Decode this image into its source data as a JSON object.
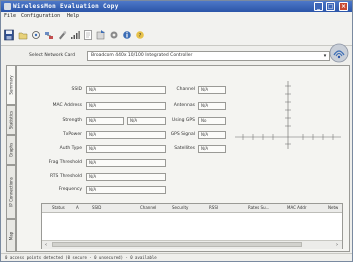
{
  "window": {
    "title": "WirelessMon Evaluation Copy",
    "controls": {
      "minimize": "_",
      "maximize": "□",
      "close": "×"
    }
  },
  "menu": {
    "file": "File",
    "configuration": "Configuration",
    "help": "Help"
  },
  "toolbar": {
    "icons": [
      "save-icon",
      "open-icon",
      "connect-icon",
      "network-icon",
      "tools-icon",
      "signal-icon",
      "log-icon",
      "export-icon",
      "settings-icon",
      "info-icon",
      "help-icon",
      "wireless-logo"
    ]
  },
  "network_card": {
    "label": "Select Network Card",
    "value": "Broadcom 440x 10/100 Integrated Controller"
  },
  "tabs": [
    "Summary",
    "Statistics",
    "Graphs",
    "IP Connections",
    "Map"
  ],
  "fields_left": [
    {
      "label": "SSID",
      "value": "N/A"
    },
    {
      "label": "MAC Address",
      "value": "N/A"
    },
    {
      "label": "Strength",
      "value": "N/A",
      "extra": "N/A"
    },
    {
      "label": "TxPower",
      "value": "N/A"
    },
    {
      "label": "Auth Type",
      "value": "N/A"
    },
    {
      "label": "Frag Threshold",
      "value": "N/A"
    },
    {
      "label": "RTS Threshold",
      "value": "N/A"
    },
    {
      "label": "Frequency",
      "value": "N/A"
    }
  ],
  "fields_right": [
    {
      "label": "Channel",
      "value": "N/A"
    },
    {
      "label": "Antennas",
      "value": "N/A"
    },
    {
      "label": "Using GPS",
      "value": "No"
    },
    {
      "label": "GPS Signal",
      "value": "N/A"
    },
    {
      "label": "Satellites",
      "value": "N/A"
    }
  ],
  "table": {
    "columns": [
      "Status",
      "A",
      "SSID",
      "Channel",
      "Security",
      "RSSI",
      "Rates Su...",
      "MAC Addr",
      "Netw"
    ]
  },
  "status": {
    "text": "0 access points detected (0 secure - 0 unsecured) - 0 available"
  }
}
